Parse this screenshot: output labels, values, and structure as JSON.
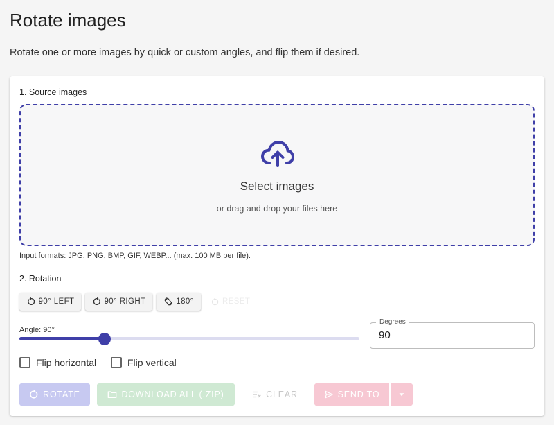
{
  "page": {
    "title": "Rotate images",
    "subtitle": "Rotate one or more images by quick or custom angles, and flip them if desired."
  },
  "source": {
    "label": "1. Source images",
    "dropzone_title": "Select images",
    "dropzone_subtitle": "or drag and drop your files here",
    "dropzone_icon": "cloud-upload-icon",
    "formats": "Input formats: JPG, PNG, BMP, GIF, WEBP... (max. 100 MB per file)."
  },
  "rotation": {
    "label": "2. Rotation",
    "quick_buttons": [
      {
        "label": "90° LEFT",
        "icon": "rotate-left-icon"
      },
      {
        "label": "90° RIGHT",
        "icon": "rotate-right-icon"
      },
      {
        "label": "180°",
        "icon": "rotate-180-icon"
      }
    ],
    "reset_label": "RESET",
    "slider_label": "Angle: 90°",
    "slider_value_fraction": 0.25,
    "degrees_label": "Degrees",
    "degrees_value": "90"
  },
  "flip": {
    "horizontal_label": "Flip horizontal",
    "vertical_label": "Flip vertical",
    "horizontal_checked": false,
    "vertical_checked": false
  },
  "actions": {
    "rotate_label": "ROTATE",
    "download_label": "DOWNLOAD ALL (.ZIP)",
    "clear_label": "CLEAR",
    "send_label": "SEND TO"
  },
  "colors": {
    "accent": "#3f3fa8",
    "rotate_btn": "#c7c9f1",
    "download_btn": "#cfe9d3",
    "send_btn": "#f7c8d3"
  }
}
